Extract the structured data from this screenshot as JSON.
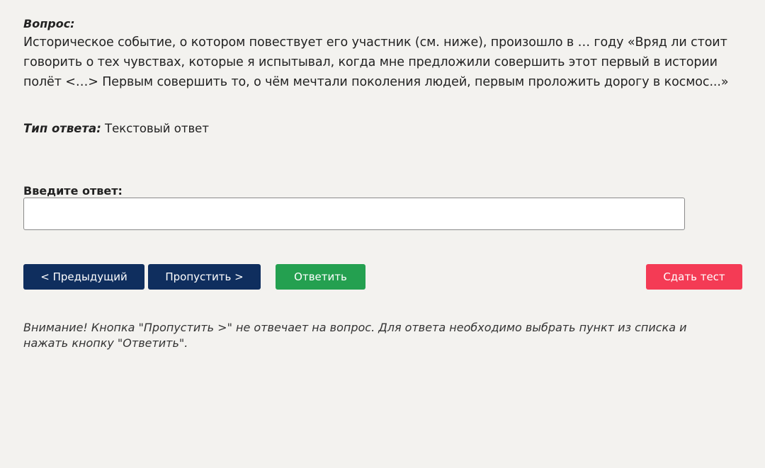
{
  "question": {
    "label": "Вопрос:",
    "text": "Историческое событие, о котором повествует его участник (см. ниже), произошло в … году «Вряд ли стоит говорить о тех чувствах, которые я испытывал, когда мне предложили совершить этот первый в истории полёт <…> Первым совершить то, о чём мечтали поколения людей, первым проложить дорогу в космос...»"
  },
  "answer_type": {
    "label": "Тип ответа:",
    "value": "Текстовый ответ"
  },
  "answer_input": {
    "label": "Введите ответ:",
    "value": "",
    "placeholder": ""
  },
  "buttons": {
    "prev": "< Предыдущий",
    "skip": "Пропустить >",
    "answer": "Ответить",
    "finish": "Сдать тест"
  },
  "colors": {
    "nav_button": "#0f2e5e",
    "answer_button": "#24a050",
    "finish_button": "#f43b55",
    "background": "#f3f2ef"
  },
  "warning": "Внимание! Кнопка \"Пропустить >\" не отвечает на вопрос. Для ответа необходимо выбрать пункт из списка и нажать кнопку \"Ответить\"."
}
